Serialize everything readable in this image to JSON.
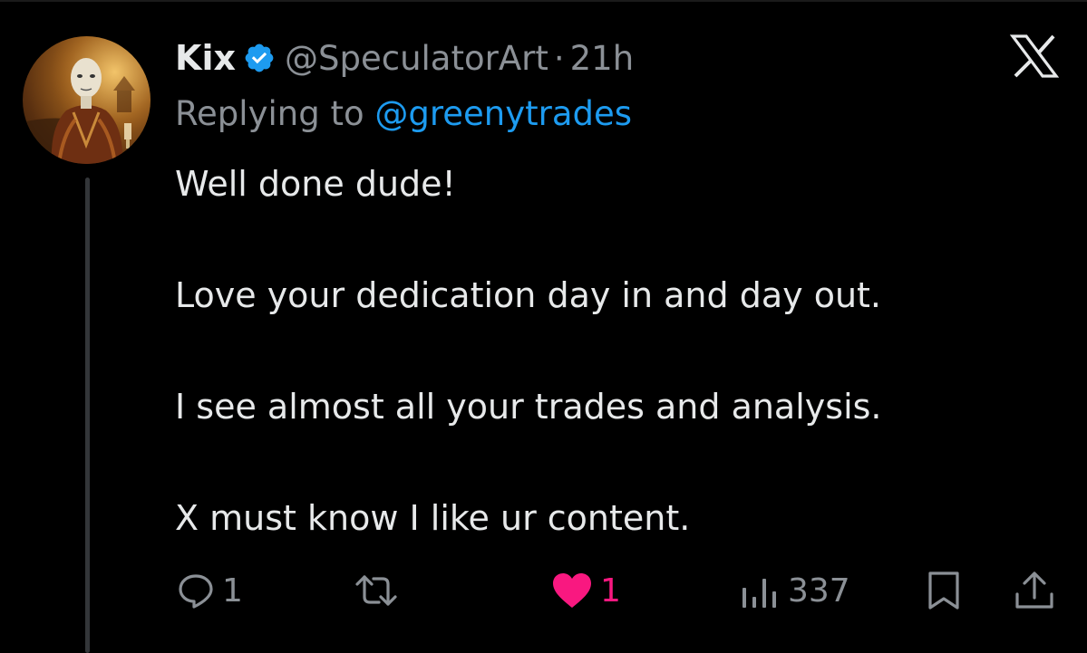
{
  "tweet": {
    "author": {
      "name": "Kix",
      "handle": "@SpeculatorArt",
      "separator": "·",
      "time": "21h",
      "verified": true,
      "avatar_icon": "avatar-painting"
    },
    "reply": {
      "prefix": "Replying to",
      "mention": "@greenytrades"
    },
    "body_lines": [
      "Well done dude!",
      "Love your dedication day in and day out.",
      "I see almost all your trades and analysis.",
      "X must know I like ur content."
    ],
    "actions": {
      "replies": "1",
      "reposts": "",
      "likes": "1",
      "liked": true,
      "views": "337"
    }
  },
  "colors": {
    "background": "#000000",
    "text": "#e7e9ea",
    "muted": "#8b9096",
    "link": "#1d9bf0",
    "like": "#f91880",
    "verified": "#1d9bf0",
    "thread_line": "#333639"
  },
  "icons": {
    "brand": "x-logo",
    "verified": "verified-badge-icon",
    "reply": "reply-icon",
    "repost": "repost-icon",
    "like": "heart-icon",
    "views": "views-icon",
    "bookmark": "bookmark-icon",
    "share": "share-icon"
  }
}
